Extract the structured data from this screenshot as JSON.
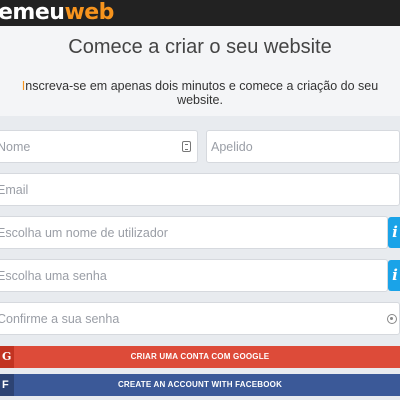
{
  "logo": {
    "part1": "emeu",
    "part2": "web"
  },
  "headline": "Comece a criar o seu website",
  "subheadline": {
    "accent": "I",
    "rest": "nscreva-se em apenas dois minutos e comece a criação do seu website."
  },
  "form": {
    "first_name_placeholder": "Nome",
    "last_name_placeholder": "Apelido",
    "email_placeholder": "Email",
    "username_placeholder": "Escolha um nome de utilizador",
    "password_placeholder": "Escolha uma senha",
    "confirm_password_placeholder": "Confirme a sua senha",
    "info_glyph": "i"
  },
  "buttons": {
    "google_label": "Criar uma conta com Google",
    "google_icon": "g",
    "facebook_label": "Create an account with Facebook",
    "facebook_icon": "f"
  },
  "colors": {
    "brand_orange": "#f7941d",
    "google_red": "#dd4b39",
    "facebook_blue": "#3b5998",
    "info_blue": "#1aa3e8"
  }
}
